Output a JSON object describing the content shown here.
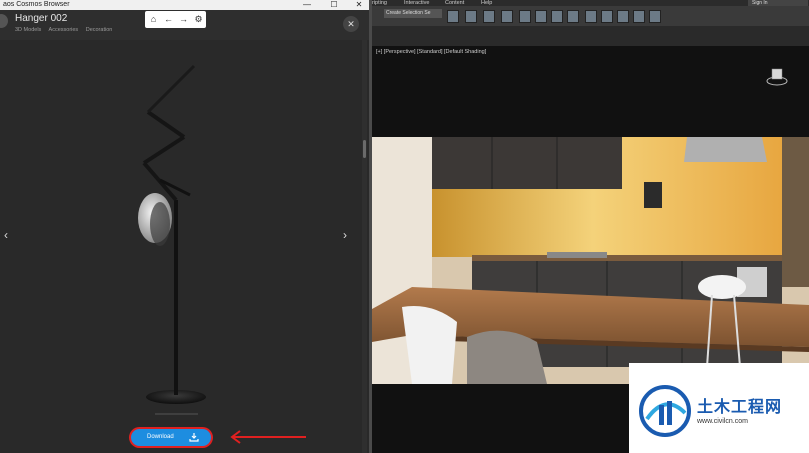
{
  "left_window": {
    "title": "aos Cosmos Browser",
    "controls": {
      "minimize": "—",
      "maximize": "☐",
      "close": "✕"
    },
    "asset_title": "Hanger 002",
    "breadcrumbs": [
      "3D Models",
      "Accessories",
      "Decoration"
    ],
    "nav_icons": [
      "home-icon",
      "back-icon",
      "forward-icon",
      "settings-icon"
    ],
    "close_label": "✕",
    "prev_arrow": "‹",
    "next_arrow": "›",
    "download_label": "Download"
  },
  "right_app": {
    "menus": [
      "ripting",
      "Interactive",
      "Content",
      "Help"
    ],
    "signin_label": "Sign In",
    "selection_dropdown": "Create Selection Se",
    "viewport_label": "[+] [Perspective] [Standard] [Default Shading]"
  },
  "watermark": {
    "brand_text": "土木工程网",
    "url": "www.civilcn.com"
  },
  "colors": {
    "accent_download": "#1d8de0",
    "highlight": "#e02020",
    "watermark_blue": "#1a5bb0"
  }
}
